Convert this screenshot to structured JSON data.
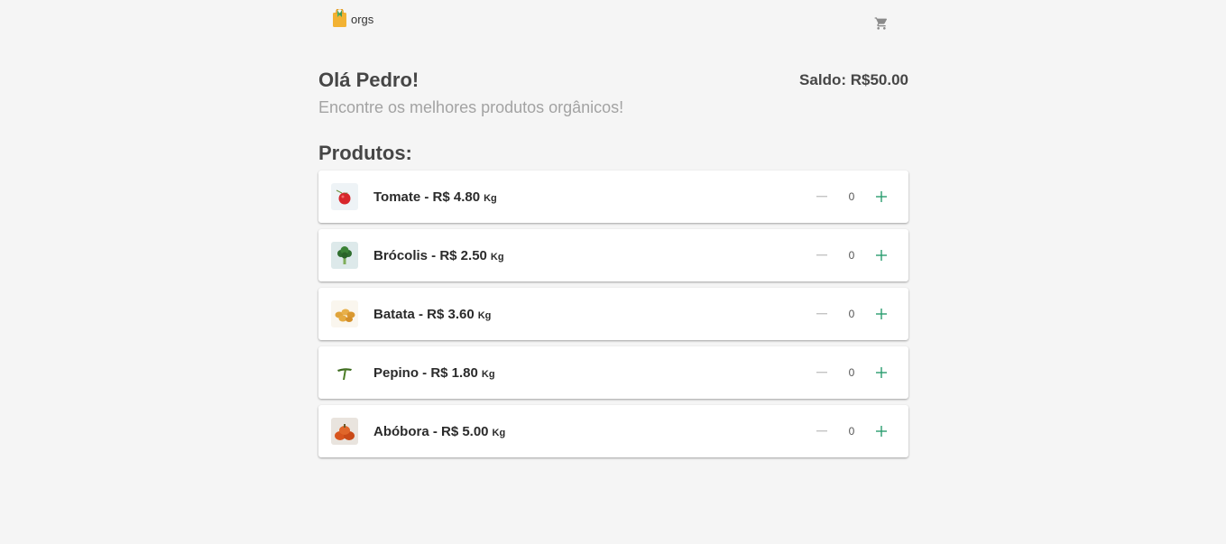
{
  "header": {
    "logo_text": "orgs",
    "cart_icon": "shopping-cart-icon"
  },
  "greeting": {
    "title": "Olá Pedro!",
    "subtitle": "Encontre os melhores produtos orgânicos!",
    "balance": "Saldo: R$50.00"
  },
  "section_title": "Produtos:",
  "colors": {
    "background": "#f5f5f5",
    "text": "#464646",
    "subtitle": "#a3a3a3",
    "accent_plus": "#2a9d6f",
    "minus_disabled": "#c4c4c4"
  },
  "products": [
    {
      "label": "Tomate - R$ 4.80",
      "unit": "Kg",
      "quantity": "0",
      "icon": "tomato-icon"
    },
    {
      "label": "Brócolis - R$ 2.50",
      "unit": "Kg",
      "quantity": "0",
      "icon": "broccoli-icon"
    },
    {
      "label": "Batata - R$ 3.60",
      "unit": "Kg",
      "quantity": "0",
      "icon": "potato-icon"
    },
    {
      "label": "Pepino - R$ 1.80",
      "unit": "Kg",
      "quantity": "0",
      "icon": "cucumber-icon"
    },
    {
      "label": "Abóbora - R$ 5.00",
      "unit": "Kg",
      "quantity": "0",
      "icon": "pumpkin-icon"
    }
  ]
}
